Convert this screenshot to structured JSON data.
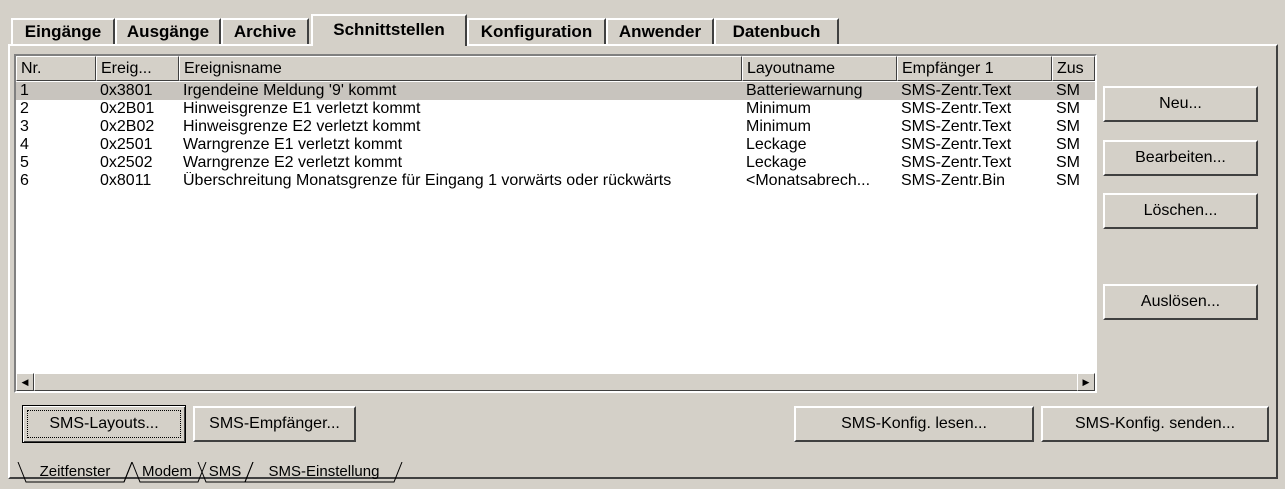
{
  "tabs": [
    {
      "label": "Eingänge",
      "active": false
    },
    {
      "label": "Ausgänge",
      "active": false
    },
    {
      "label": "Archive",
      "active": false
    },
    {
      "label": "Schnittstellen",
      "active": true
    },
    {
      "label": "Konfiguration",
      "active": false
    },
    {
      "label": "Anwender",
      "active": false
    },
    {
      "label": "Datenbuch",
      "active": false
    }
  ],
  "events_table": {
    "columns": [
      "Nr.",
      "Ereig...",
      "Ereignisname",
      "Layoutname",
      "Empfänger 1",
      "Zus"
    ],
    "rows": [
      [
        "1",
        "0x3801",
        "Irgendeine Meldung '9' kommt",
        "Batteriewarnung",
        "SMS-Zentr.Text",
        "SM"
      ],
      [
        "2",
        "0x2B01",
        "Hinweisgrenze E1 verletzt kommt",
        "Minimum",
        "SMS-Zentr.Text",
        "SM"
      ],
      [
        "3",
        "0x2B02",
        "Hinweisgrenze E2 verletzt kommt",
        "Minimum",
        "SMS-Zentr.Text",
        "SM"
      ],
      [
        "4",
        "0x2501",
        "Warngrenze E1 verletzt kommt",
        "Leckage",
        "SMS-Zentr.Text",
        "SM"
      ],
      [
        "5",
        "0x2502",
        "Warngrenze E2 verletzt kommt",
        "Leckage",
        "SMS-Zentr.Text",
        "SM"
      ],
      [
        "6",
        "0x8011",
        "Überschreitung Monatsgrenze für Eingang 1 vorwärts oder rückwärts",
        "<Monatsabrech...",
        "SMS-Zentr.Bin",
        "SM"
      ]
    ],
    "selected_row": 0
  },
  "side_buttons": {
    "new_label": "Neu...",
    "edit_label": "Bearbeiten...",
    "delete_label": "Löschen...",
    "trigger_label": "Auslösen..."
  },
  "bottom_buttons": {
    "layouts_label": "SMS-Layouts...",
    "recipients_label": "SMS-Empfänger...",
    "read_config_label": "SMS-Konfig. lesen...",
    "send_config_label": "SMS-Konfig. senden..."
  },
  "sheet_tabs": [
    {
      "label": "Zeitfenster",
      "active": false
    },
    {
      "label": "Modem",
      "active": false
    },
    {
      "label": "SMS",
      "active": true
    },
    {
      "label": "SMS-Einstellung",
      "active": false
    }
  ],
  "colors": {
    "face": "#d4d0c8",
    "selection": "#c8c4be",
    "highlight": "#ffffff",
    "shadow": "#404040"
  },
  "icons": {
    "scroll_left": "◀",
    "scroll_right": "▶"
  }
}
